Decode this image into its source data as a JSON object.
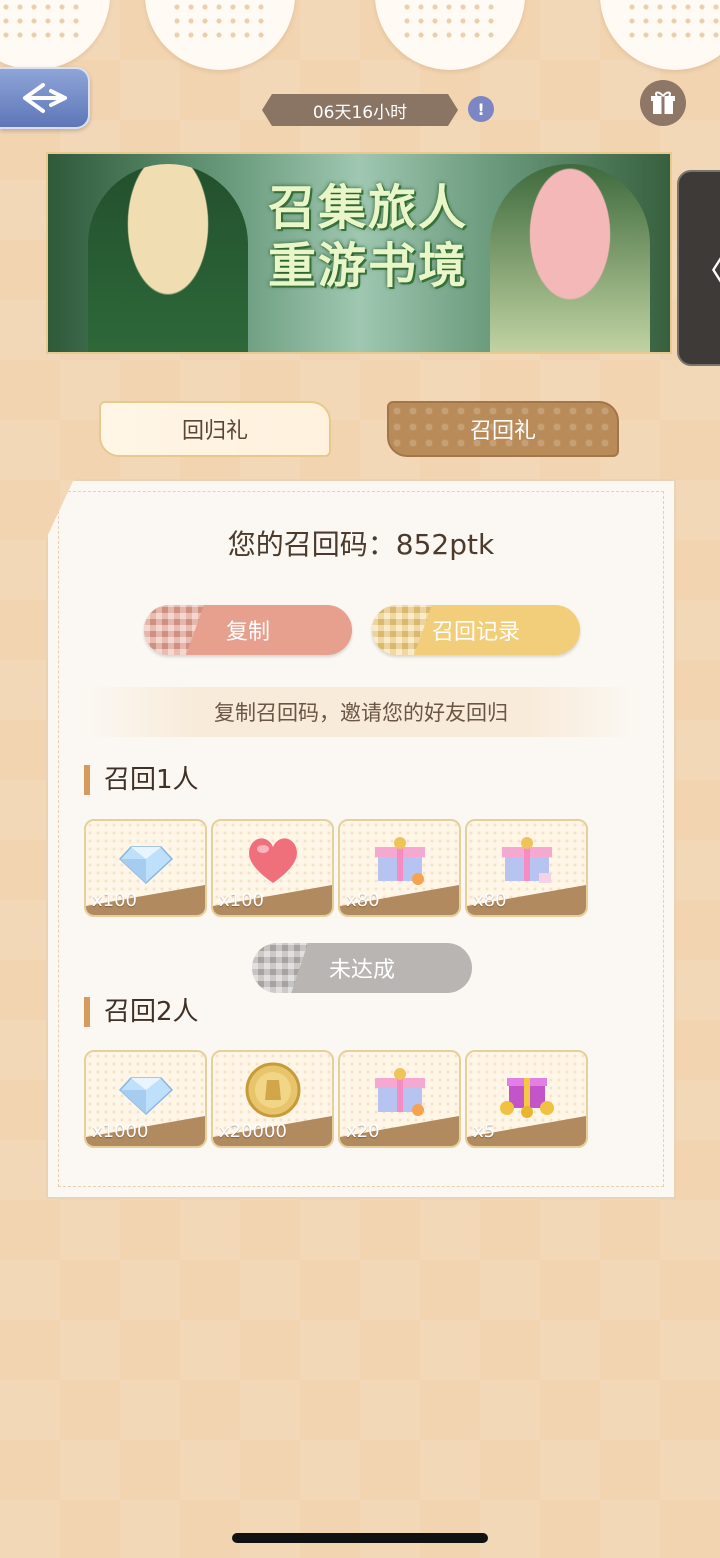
{
  "header": {
    "countdown": "06天16小时",
    "info_label": "!"
  },
  "banner": {
    "title_line1": "召集旅人",
    "title_line2": "重游书境"
  },
  "side_tab": {
    "label": "〈"
  },
  "tabs": [
    {
      "label": "回归礼",
      "active": false
    },
    {
      "label": "召回礼",
      "active": true
    }
  ],
  "panel": {
    "code_label": "您的召回码：852ptk",
    "copy_button": "复制",
    "record_button": "召回记录",
    "hint": "复制召回码，邀请您的好友回归",
    "sections": [
      {
        "title": "召回1人",
        "rewards": [
          {
            "icon": "diamond-icon",
            "count": "x100"
          },
          {
            "icon": "heart-icon",
            "count": "x100"
          },
          {
            "icon": "gift-box-icon",
            "count": "x80"
          },
          {
            "icon": "gift-box-icon",
            "count": "x80"
          }
        ],
        "status": "未达成"
      },
      {
        "title": "召回2人",
        "rewards": [
          {
            "icon": "diamond-icon",
            "count": "x1000"
          },
          {
            "icon": "gold-coin-icon",
            "count": "x20000"
          },
          {
            "icon": "gift-box-icon",
            "count": "x20"
          },
          {
            "icon": "gold-gift-pile-icon",
            "count": "x5"
          }
        ]
      }
    ]
  },
  "colors": {
    "background": "#f2d4b0",
    "accent": "#b88b58",
    "copy_pill": "#e7a08d",
    "record_pill": "#f2cd7a",
    "status_pill": "#b9b5b2"
  }
}
